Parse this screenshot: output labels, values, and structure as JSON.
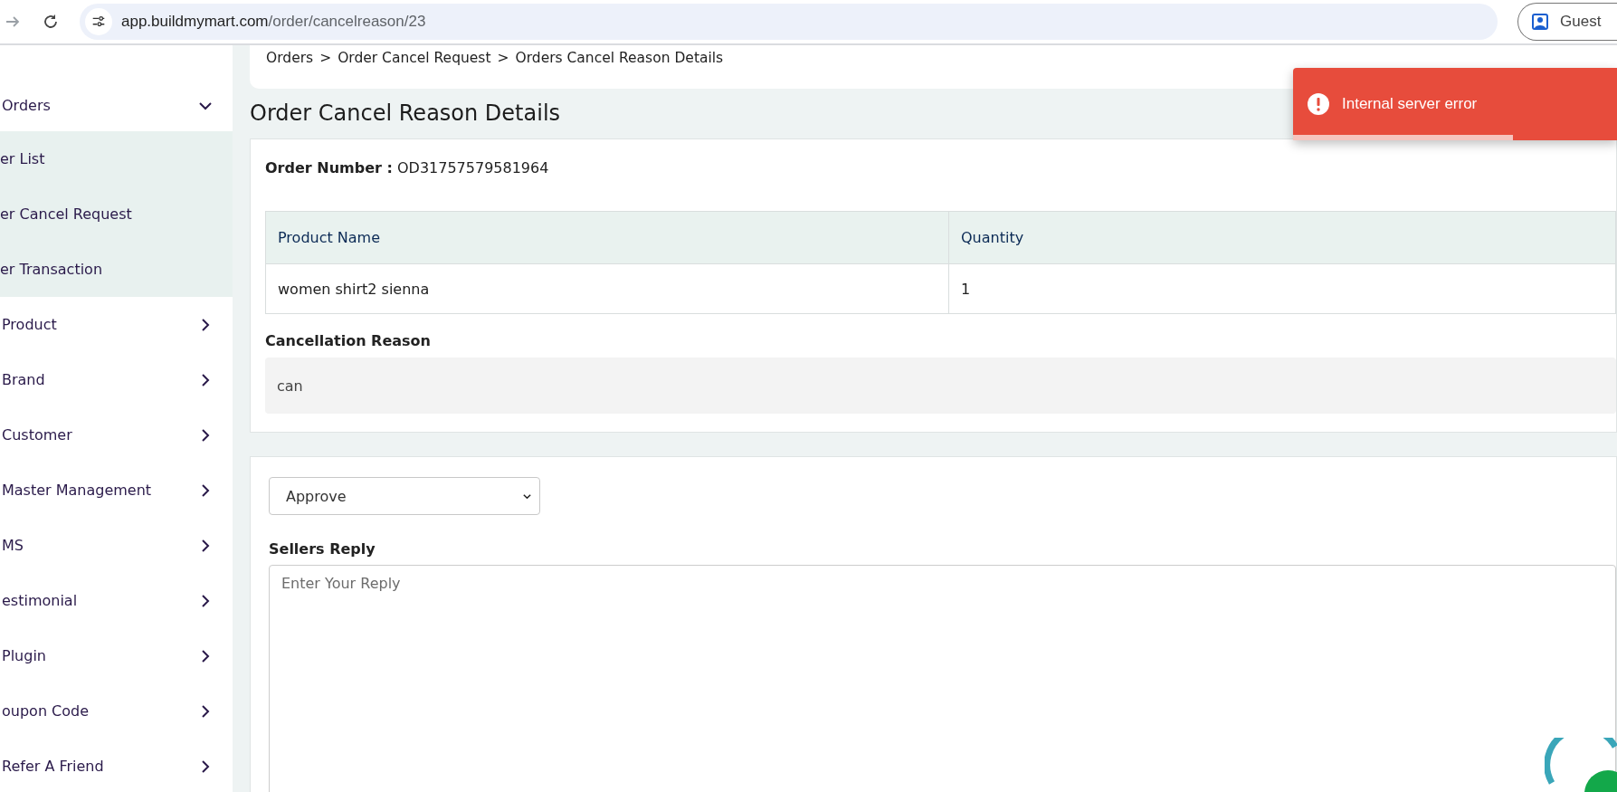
{
  "browser": {
    "url_host": "app.buildmymart.com",
    "url_path": "/order/cancelreason/23",
    "profile": "Guest"
  },
  "sidebar": {
    "items": [
      {
        "label": "Orders",
        "expanded": true,
        "children": [
          {
            "label": "er List"
          },
          {
            "label": "er Cancel Request"
          },
          {
            "label": "er Transaction"
          }
        ]
      },
      {
        "label": "Product",
        "expanded": false
      },
      {
        "label": "Brand",
        "expanded": false
      },
      {
        "label": "Customer",
        "expanded": false
      },
      {
        "label": "Master Management",
        "expanded": false
      },
      {
        "label": "MS",
        "expanded": false
      },
      {
        "label": "estimonial",
        "expanded": false
      },
      {
        "label": "Plugin",
        "expanded": false
      },
      {
        "label": "oupon Code",
        "expanded": false
      },
      {
        "label": "Refer A Friend",
        "expanded": false
      }
    ]
  },
  "breadcrumb": [
    "Orders",
    "Order Cancel Request",
    "Orders Cancel Reason Details"
  ],
  "breadcrumb_separator": ">",
  "page_title": "Order Cancel Reason Details",
  "order_number": {
    "label": "Order Number :",
    "value": "OD31757579581964"
  },
  "table": {
    "columns": [
      "Product Name",
      "Quantity"
    ],
    "rows": [
      [
        "women shirt2 sienna",
        "1"
      ]
    ]
  },
  "cancellation": {
    "label": "Cancellation Reason",
    "value": "can"
  },
  "reply_form": {
    "status": "Approve",
    "label": "Sellers Reply",
    "placeholder": "Enter Your Reply"
  },
  "toast": {
    "message": "Internal server error",
    "level": 0.68
  }
}
